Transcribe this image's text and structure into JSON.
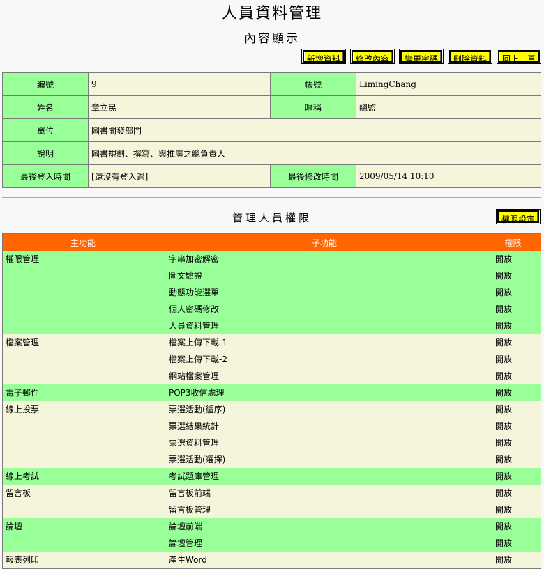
{
  "page": {
    "title": "人員資料管理",
    "subtitle": "內容顯示"
  },
  "toolbar": {
    "add": "新增資料",
    "edit": "修改內容",
    "password": "變更密碼",
    "delete": "刪除資料",
    "back": "回上一頁"
  },
  "info": {
    "id_label": "編號",
    "id_value": "9",
    "account_label": "帳號",
    "account_value": "LimingChang",
    "name_label": "姓名",
    "name_value": "章立民",
    "nick_label": "暱稱",
    "nick_value": "總監",
    "unit_label": "單位",
    "unit_value": "圖書開發部門",
    "desc_label": "說明",
    "desc_value": "圖書規劃、撰寫、與推廣之總負責人",
    "last_login_label": "最後登入時間",
    "last_login_value": "[還沒有登入過]",
    "last_modified_label": "最後修改時間",
    "last_modified_value": "2009/05/14 10:10"
  },
  "perm": {
    "title": "管理人員權限",
    "settings_button": "權限設定",
    "headers": {
      "main": "主功能",
      "sub": "子功能",
      "access": "權限"
    },
    "groups": [
      {
        "main": "權限管理",
        "subs": [
          "字串加密解密",
          "圖文驗證",
          "動態功能選單",
          "個人密碼修改",
          "人員資料管理"
        ],
        "access": [
          "開放",
          "開放",
          "開放",
          "開放",
          "開放"
        ]
      },
      {
        "main": "檔案管理",
        "subs": [
          "檔案上傳下載-1",
          "檔案上傳下載-2",
          "網站檔案管理"
        ],
        "access": [
          "開放",
          "開放",
          "開放"
        ]
      },
      {
        "main": "電子郵件",
        "subs": [
          "POP3收信處理"
        ],
        "access": [
          "開放"
        ]
      },
      {
        "main": "線上投票",
        "subs": [
          "票選活動(循序)",
          "票選結果統計",
          "票選資料管理",
          "票選活動(選擇)"
        ],
        "access": [
          "開放",
          "開放",
          "開放",
          "開放"
        ]
      },
      {
        "main": "線上考試",
        "subs": [
          "考試題庫管理"
        ],
        "access": [
          "開放"
        ]
      },
      {
        "main": "留言板",
        "subs": [
          "留言板前端",
          "留言板管理"
        ],
        "access": [
          "開放",
          "開放"
        ]
      },
      {
        "main": "論壇",
        "subs": [
          "論壇前端",
          "論壇管理"
        ],
        "access": [
          "開放",
          "開放"
        ]
      },
      {
        "main": "報表列印",
        "subs": [
          "產生Word"
        ],
        "access": [
          "開放"
        ]
      }
    ]
  },
  "colors": {
    "header_orange": "#ff6600",
    "row_green": "#99ff99",
    "row_beige": "#f5f5dc",
    "button_yellow": "#ffff00"
  }
}
